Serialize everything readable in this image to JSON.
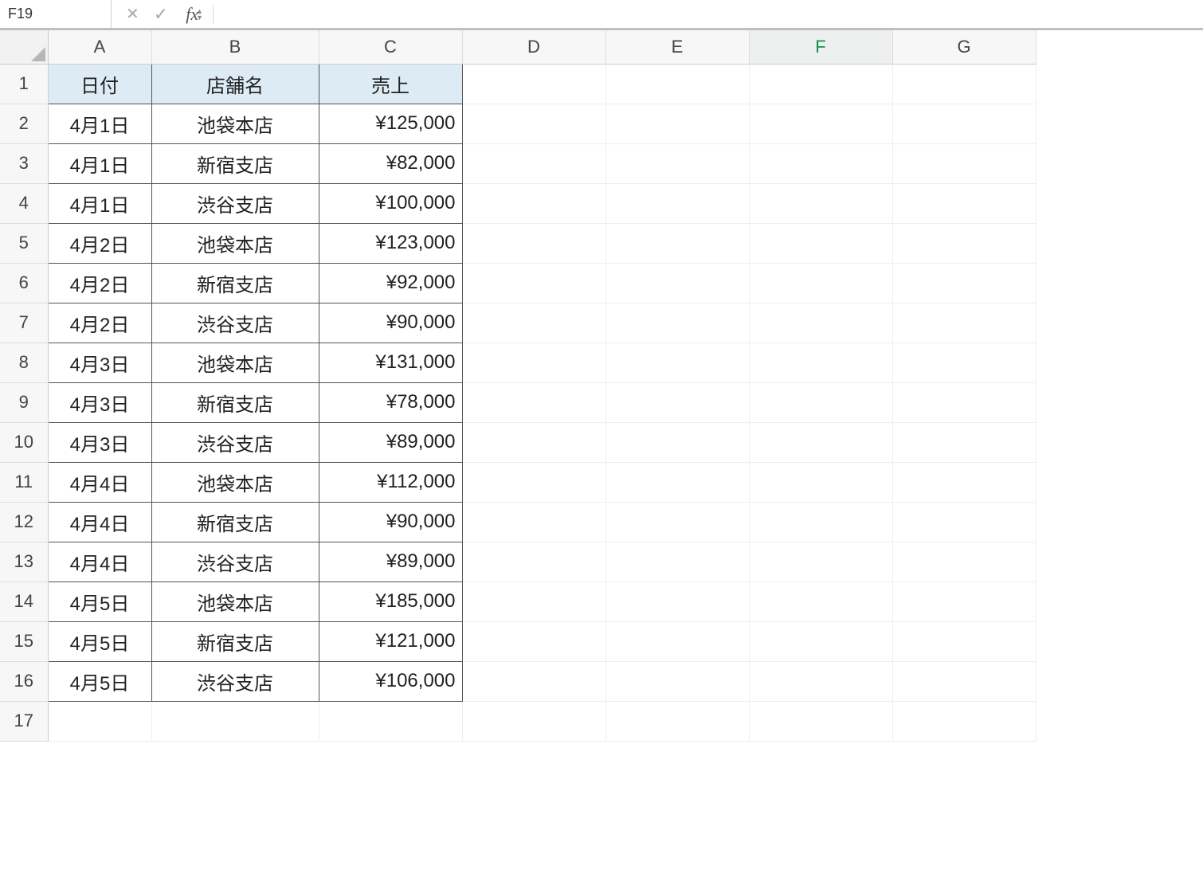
{
  "formula_bar": {
    "name_box": "F19",
    "fx_label": "fx",
    "formula_value": ""
  },
  "columns": [
    "A",
    "B",
    "C",
    "D",
    "E",
    "F",
    "G"
  ],
  "selected_column": "F",
  "row_count": 17,
  "headers": {
    "A": "日付",
    "B": "店舗名",
    "C": "売上"
  },
  "rows": [
    {
      "A": "4月1日",
      "B": "池袋本店",
      "C": "¥125,000"
    },
    {
      "A": "4月1日",
      "B": "新宿支店",
      "C": "¥82,000"
    },
    {
      "A": "4月1日",
      "B": "渋谷支店",
      "C": "¥100,000"
    },
    {
      "A": "4月2日",
      "B": "池袋本店",
      "C": "¥123,000"
    },
    {
      "A": "4月2日",
      "B": "新宿支店",
      "C": "¥92,000"
    },
    {
      "A": "4月2日",
      "B": "渋谷支店",
      "C": "¥90,000"
    },
    {
      "A": "4月3日",
      "B": "池袋本店",
      "C": "¥131,000"
    },
    {
      "A": "4月3日",
      "B": "新宿支店",
      "C": "¥78,000"
    },
    {
      "A": "4月3日",
      "B": "渋谷支店",
      "C": "¥89,000"
    },
    {
      "A": "4月4日",
      "B": "池袋本店",
      "C": "¥112,000"
    },
    {
      "A": "4月4日",
      "B": "新宿支店",
      "C": "¥90,000"
    },
    {
      "A": "4月4日",
      "B": "渋谷支店",
      "C": "¥89,000"
    },
    {
      "A": "4月5日",
      "B": "池袋本店",
      "C": "¥185,000"
    },
    {
      "A": "4月5日",
      "B": "新宿支店",
      "C": "¥121,000"
    },
    {
      "A": "4月5日",
      "B": "渋谷支店",
      "C": "¥106,000"
    }
  ]
}
